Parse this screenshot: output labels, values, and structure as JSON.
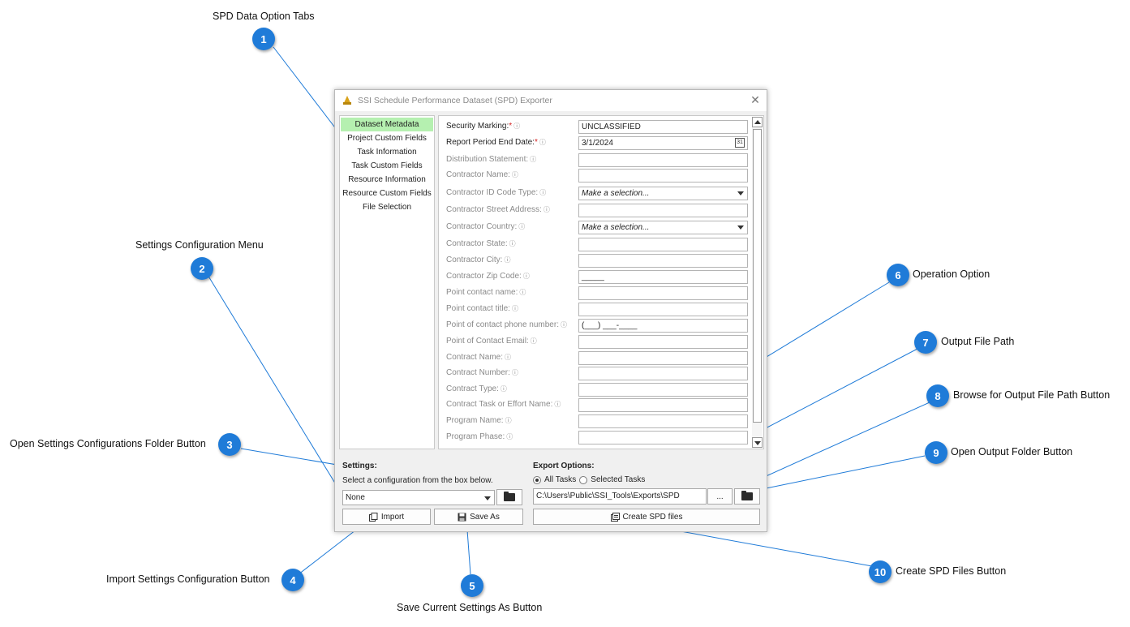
{
  "window": {
    "title": "SSI Schedule Performance Dataset (SPD) Exporter",
    "close_glyph": "✕"
  },
  "tabs": [
    {
      "label": "Dataset Metadata",
      "active": true
    },
    {
      "label": "Project Custom Fields"
    },
    {
      "label": "Task Information"
    },
    {
      "label": "Task Custom Fields"
    },
    {
      "label": "Resource Information"
    },
    {
      "label": "Resource Custom Fields"
    },
    {
      "label": "File Selection"
    }
  ],
  "fields": [
    {
      "label": "Security Marking:",
      "required": true,
      "value": "UNCLASSIFIED"
    },
    {
      "label": "Report Period End Date:",
      "required": true,
      "value": "3/1/2024",
      "type": "date"
    },
    {
      "label": "Distribution Statement:",
      "value": ""
    },
    {
      "label": "Contractor Name:",
      "value": ""
    },
    {
      "label": "Contractor ID Code Type:",
      "value": "Make a selection...",
      "type": "select"
    },
    {
      "label": "Contractor Street Address:",
      "value": ""
    },
    {
      "label": "Contractor Country:",
      "value": "Make a selection...",
      "type": "select"
    },
    {
      "label": "Contractor State:",
      "value": ""
    },
    {
      "label": "Contractor City:",
      "value": ""
    },
    {
      "label": "Contractor Zip Code:",
      "value": "_____"
    },
    {
      "label": "Point contact name:",
      "value": ""
    },
    {
      "label": "Point contact title:",
      "value": ""
    },
    {
      "label": "Point of contact phone number:",
      "value": "(___) ___-____"
    },
    {
      "label": "Point of Contact Email:",
      "value": ""
    },
    {
      "label": "Contract Name:",
      "value": ""
    },
    {
      "label": "Contract Number:",
      "value": ""
    },
    {
      "label": "Contract Type:",
      "value": ""
    },
    {
      "label": "Contract Task or Effort Name:",
      "value": ""
    },
    {
      "label": "Program Name:",
      "value": ""
    },
    {
      "label": "Program Phase:",
      "value": ""
    }
  ],
  "required_star": "*",
  "info_glyph": "ⓘ",
  "date_icon_text": "31",
  "settings": {
    "title": "Settings:",
    "hint": "Select a configuration from the box below.",
    "selected": "None",
    "import_label": "Import",
    "save_as_label": "Save As"
  },
  "export": {
    "title": "Export Options:",
    "option_all": "All Tasks",
    "option_selected": "Selected Tasks",
    "selected_option": "All Tasks",
    "path": "C:\\Users\\Public\\SSI_Tools\\Exports\\SPD",
    "browse_label": "...",
    "create_label": "Create SPD files"
  },
  "callouts": [
    {
      "num": "1",
      "text": "SPD Data Option Tabs"
    },
    {
      "num": "2",
      "text": "Settings Configuration Menu"
    },
    {
      "num": "3",
      "text": "Open Settings Configurations Folder Button"
    },
    {
      "num": "4",
      "text": "Import Settings Configuration Button"
    },
    {
      "num": "5",
      "text": "Save Current Settings As Button"
    },
    {
      "num": "6",
      "text": "Operation Option"
    },
    {
      "num": "7",
      "text": "Output File Path"
    },
    {
      "num": "8",
      "text": "Browse for Output File Path Button"
    },
    {
      "num": "9",
      "text": "Open Output Folder Button"
    },
    {
      "num": "10",
      "text": "Create SPD Files Button"
    }
  ],
  "colors": {
    "accent": "#1f7bd8",
    "active_tab": "#b5f0b0",
    "required": "#d32020"
  }
}
